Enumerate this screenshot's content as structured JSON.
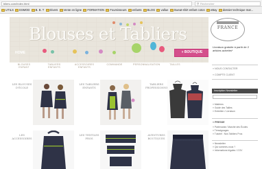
{
  "browser": {
    "url": "bliers.com/index.html",
    "search_placeholder": "Rechercher",
    "bookmarks": [
      "UTILS",
      "ESMOD",
      "B. B. T",
      "Divers",
      "Vente en ligne",
      "FORMATION",
      "Fournisseurs",
      "enfants",
      "BLOG",
      "vallue",
      "Sweat-shirt enfant coton",
      "eBay",
      "dossier technique mar..."
    ]
  },
  "header": {
    "logo": "Blouses et Tabliers",
    "home": "HOME",
    "boutique": "» BOUTIQUE"
  },
  "nav": {
    "items": [
      "BLOUSES ENFANT",
      "TABLIERS ENFANTS",
      "ACCESSOIRES ENFANTS",
      "COMMANDE",
      "PERSONNALISATION",
      "TAILLES"
    ]
  },
  "sidebar": {
    "seal": "FRANCE",
    "promo": "Livraison gratuite à partir de 2 articles achetés*",
    "link1": "» NOUS CONTACTER",
    "link2": "» COMPTE CLIENT",
    "newsletter": "Inscription Newsletter",
    "list1": [
      "» Matières",
      "» Guide des Tailles",
      "» Entretien / Livraison"
    ],
    "presse_title": "» PRESSE",
    "list2": [
      "» Partenariat / Marché des Écoles",
      "» Témoignages",
      "» Tutoriel : Nos Tabliers Pros"
    ],
    "list3": [
      "» Newsletter",
      "» Qui sommes-nous ?",
      "» Informations légales / CGV"
    ]
  },
  "grid": {
    "labels": [
      "LES BLOUSES D'ÉCOLE",
      "LES TABLIERS ENFANTS",
      "TABLIERS PROFESSIONNELS",
      "LES ACCESSOIRES",
      "LES TEXTILES PROS",
      "AVENTURES BOUTIQUES"
    ]
  },
  "colors": {
    "accent": "#d44f8c",
    "banner": "#e9e5dc",
    "apron_dark": "#2f3347",
    "apron_trim": "#9ac230"
  }
}
